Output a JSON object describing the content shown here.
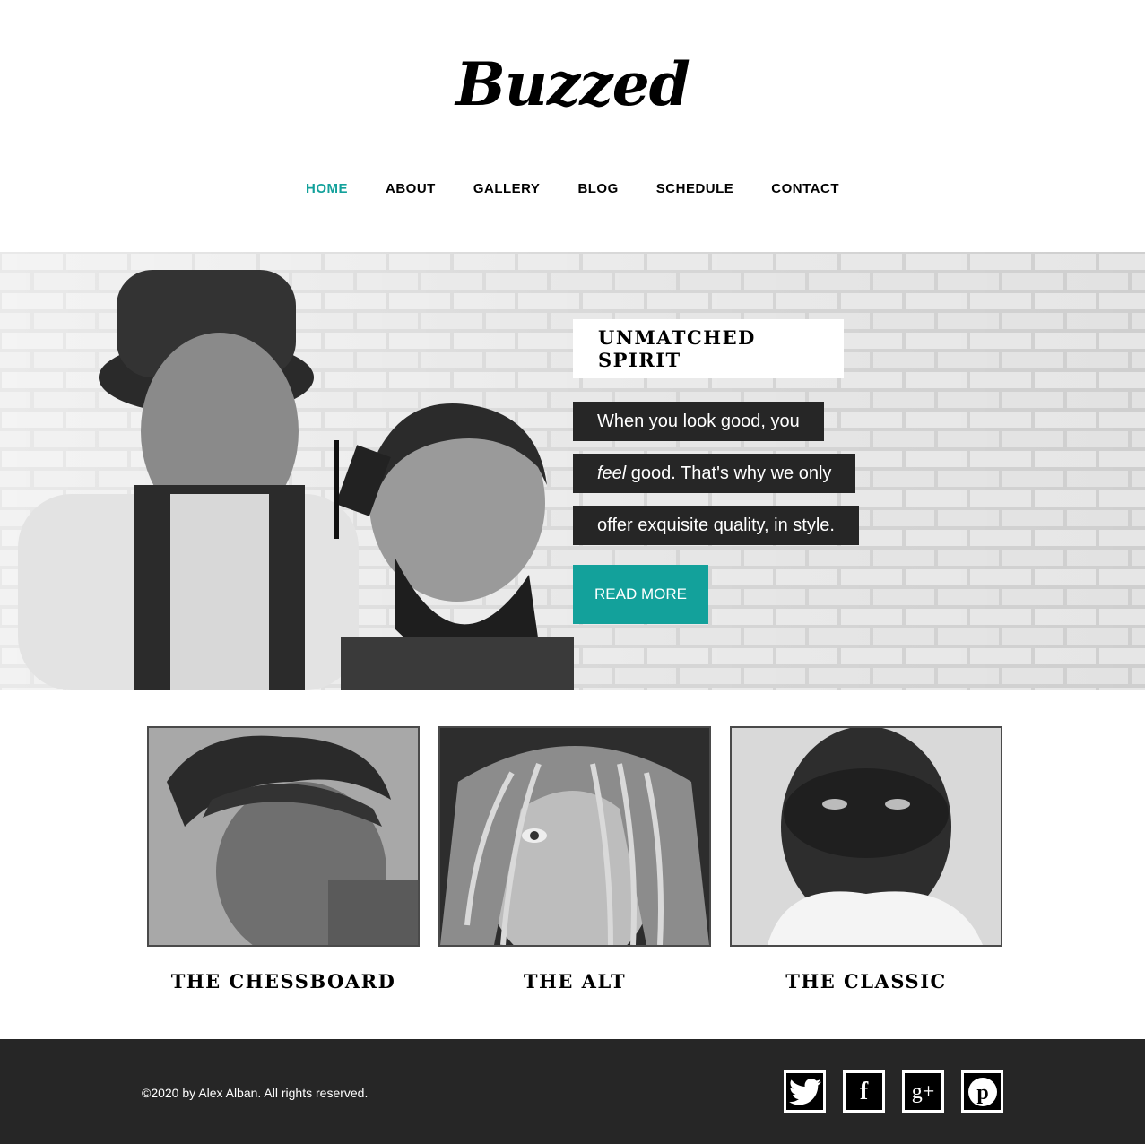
{
  "header": {
    "logo_text": "Buzzed"
  },
  "nav": {
    "items": [
      {
        "label": "HOME",
        "active": true
      },
      {
        "label": "ABOUT",
        "active": false
      },
      {
        "label": "GALLERY",
        "active": false
      },
      {
        "label": "BLOG",
        "active": false
      },
      {
        "label": "SCHEDULE",
        "active": false
      },
      {
        "label": "CONTACT",
        "active": false
      }
    ]
  },
  "hero": {
    "headline": "UNMATCHED SPIRIT",
    "lines": {
      "line1": "When you look good, you",
      "line2_emphasis": "feel",
      "line2_rest": " good. That's why we only",
      "line3": "offer exquisite quality, in style."
    },
    "button_label": "READ MORE"
  },
  "styles": {
    "items": [
      {
        "title": "THE CHESSBOARD"
      },
      {
        "title": "THE ALT"
      },
      {
        "title": "THE CLASSIC"
      }
    ]
  },
  "footer": {
    "copyright": "©2020 by Alex Alban. All rights reserved.",
    "social": [
      "twitter-icon",
      "facebook-icon",
      "google-plus-icon",
      "pinterest-icon"
    ]
  },
  "colors": {
    "accent": "#13a19b",
    "dark": "#262626",
    "white": "#ffffff"
  }
}
